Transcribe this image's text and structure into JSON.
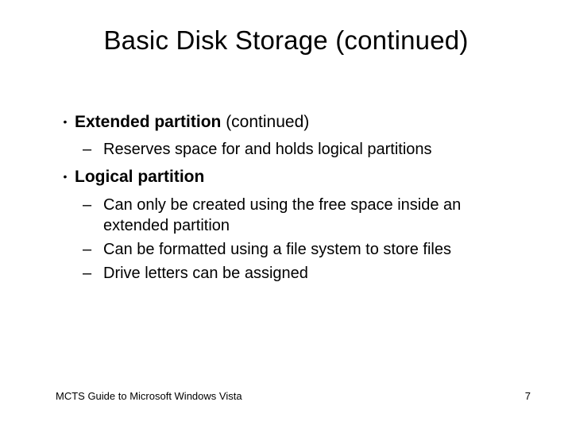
{
  "title": "Basic Disk Storage (continued)",
  "bullets": [
    {
      "bold": "Extended partition",
      "rest": " (continued)",
      "subs": [
        "Reserves space for and holds logical partitions"
      ]
    },
    {
      "bold": "Logical partition",
      "rest": "",
      "subs": [
        "Can only be created using the free space inside an extended partition",
        "Can be formatted using a file system to store files",
        "Drive letters can be assigned"
      ]
    }
  ],
  "footer_left": "MCTS Guide to Microsoft Windows Vista",
  "footer_right": "7"
}
